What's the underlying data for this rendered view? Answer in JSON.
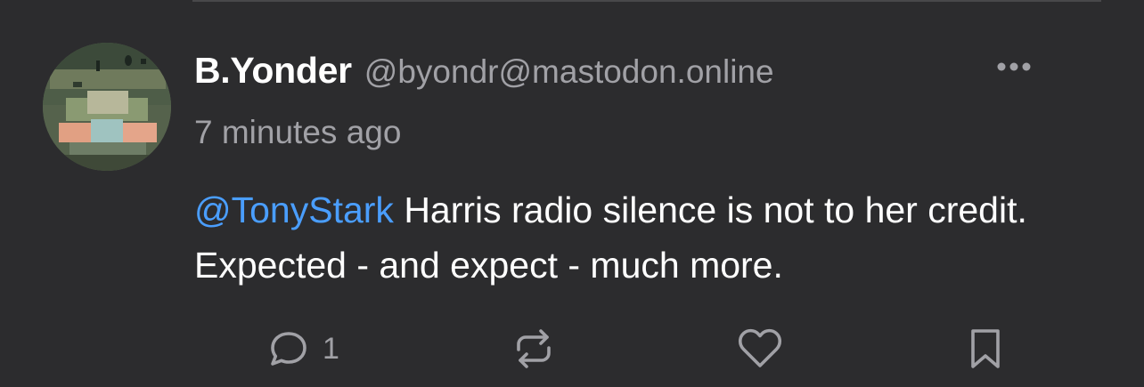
{
  "post": {
    "author": {
      "display_name": "B.Yonder",
      "handle": "@byondr@mastodon.online"
    },
    "timestamp": "7 minutes ago",
    "content": {
      "mention": "@TonyStark",
      "text": " Harris radio silence is not to her credit. Expected - and expect - much more."
    },
    "actions": {
      "reply_count": "1",
      "reply_icon": "speech-bubble-icon",
      "boost_icon": "repeat-arrows-icon",
      "favourite_icon": "heart-icon",
      "bookmark_icon": "bookmark-icon",
      "more_icon": "ellipsis-icon"
    }
  },
  "colors": {
    "background": "#2c2c2e",
    "text_primary": "#ffffff",
    "text_secondary": "#a1a1a6",
    "link": "#4a9eff",
    "divider": "#48484a"
  }
}
